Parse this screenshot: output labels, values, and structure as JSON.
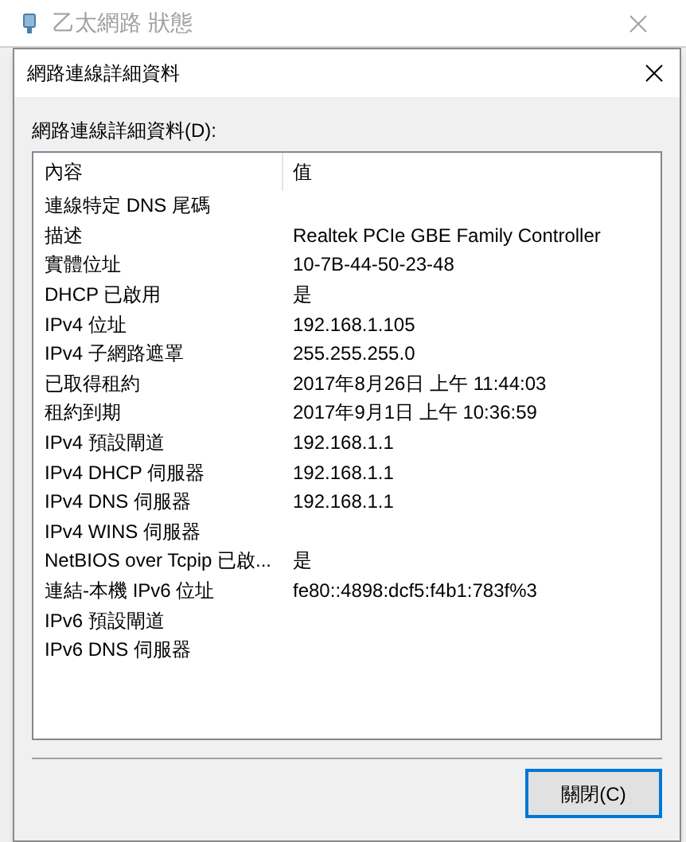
{
  "parent_window": {
    "title": "乙太網路 狀態"
  },
  "dialog": {
    "title": "網路連線詳細資料",
    "list_label": "網路連線詳細資料(D):",
    "table": {
      "columns": [
        "內容",
        "值"
      ],
      "rows": [
        {
          "property": "連線特定 DNS 尾碼"
        },
        {
          "property": "描述",
          "value": "Realtek PCIe GBE Family Controller"
        },
        {
          "property": "實體位址",
          "value": "10-7B-44-50-23-48"
        },
        {
          "property": "DHCP 已啟用",
          "value": "是"
        },
        {
          "property": "IPv4 位址",
          "value": "192.168.1.105"
        },
        {
          "property": "IPv4 子網路遮罩",
          "value": "255.255.255.0"
        },
        {
          "property": "已取得租約",
          "value": "2017年8月26日 上午 11:44:03"
        },
        {
          "property": "租約到期",
          "value": "2017年9月1日 上午 10:36:59"
        },
        {
          "property": "IPv4 預設閘道",
          "value": "192.168.1.1"
        },
        {
          "property": "IPv4 DHCP 伺服器",
          "value": "192.168.1.1"
        },
        {
          "property": "IPv4 DNS 伺服器",
          "value": "192.168.1.1"
        },
        {
          "property": "IPv4 WINS 伺服器"
        },
        {
          "property": "NetBIOS over Tcpip 已啟...",
          "value": "是"
        },
        {
          "property": "連結-本機 IPv6 位址",
          "value": "fe80::4898:dcf5:f4b1:783f%3"
        },
        {
          "property": "IPv6 預設閘道"
        },
        {
          "property": "IPv6 DNS 伺服器"
        }
      ]
    },
    "close_button": "關閉(C)"
  }
}
